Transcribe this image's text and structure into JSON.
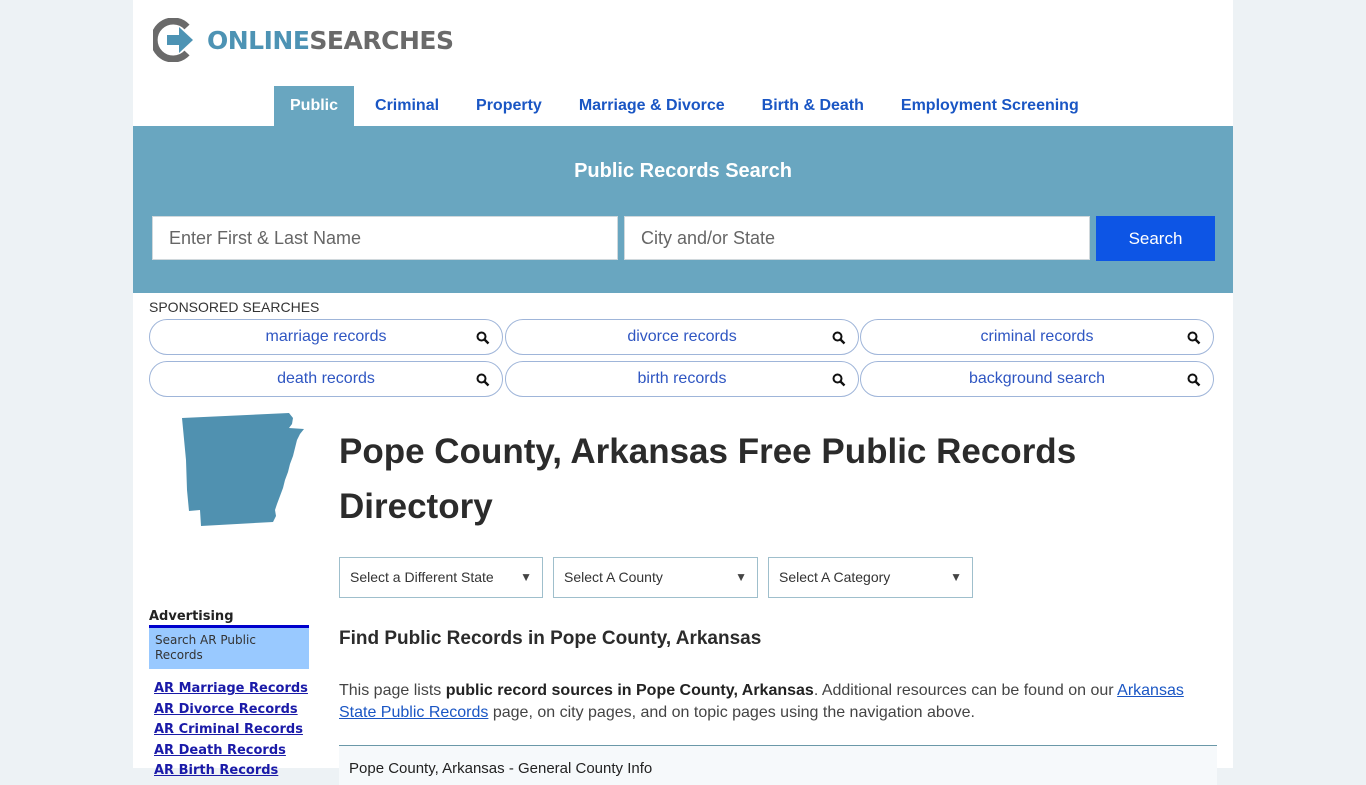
{
  "brand": {
    "logo_online": "ONLINE",
    "logo_searches": "SEARCHES",
    "colors": {
      "brand_blue": "#4d93b4",
      "brand_gray": "#6a6a6a",
      "hero_bg": "#69a6c0",
      "search_button": "#0d55e5",
      "nav_link": "#1a56c4"
    }
  },
  "nav": {
    "items": [
      {
        "label": "Public",
        "active": true
      },
      {
        "label": "Criminal",
        "active": false
      },
      {
        "label": "Property",
        "active": false
      },
      {
        "label": "Marriage & Divorce",
        "active": false
      },
      {
        "label": "Birth & Death",
        "active": false
      },
      {
        "label": "Employment Screening",
        "active": false
      }
    ]
  },
  "hero": {
    "title": "Public Records Search",
    "name_placeholder": "Enter First & Last Name",
    "name_value": "",
    "city_placeholder": "City and/or State",
    "city_value": "",
    "search_label": "Search"
  },
  "sponsored": {
    "label": "SPONSORED SEARCHES",
    "items": [
      {
        "label": "marriage records",
        "icon": "search-icon"
      },
      {
        "label": "divorce records",
        "icon": "search-icon"
      },
      {
        "label": "criminal records",
        "icon": "search-icon"
      },
      {
        "label": "death records",
        "icon": "search-icon"
      },
      {
        "label": "birth records",
        "icon": "search-icon"
      },
      {
        "label": "background search",
        "icon": "search-icon"
      }
    ]
  },
  "main": {
    "title": "Pope County, Arkansas Free Public Records Directory",
    "state_map_icon": "arkansas-map-icon",
    "selects": [
      {
        "label": "Select a Different State"
      },
      {
        "label": "Select A County"
      },
      {
        "label": "Select A Category"
      }
    ],
    "section_heading": "Find Public Records in Pope County, Arkansas",
    "intro": {
      "prefix": "This page lists ",
      "bold": "public record sources in Pope County, Arkansas",
      "middle": ". Additional resources can be found on our ",
      "link": "Arkansas State Public Records",
      "suffix": " page, on city pages, and on topic pages using the navigation above."
    },
    "info_box_title": "Pope County, Arkansas - General County Info"
  },
  "sidebar": {
    "advertising_label": "Advertising",
    "ad_box_text": "Search AR Public Records",
    "links": [
      "AR Marriage Records",
      "AR Divorce Records",
      "AR Criminal Records",
      "AR Death Records",
      "AR Birth Records"
    ]
  }
}
